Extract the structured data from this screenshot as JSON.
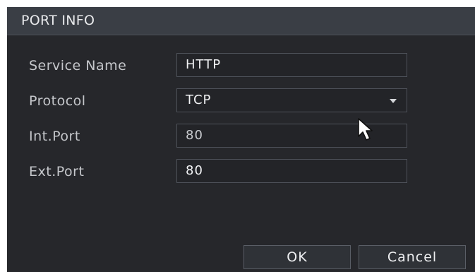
{
  "dialog": {
    "title": "PORT INFO",
    "fields": [
      {
        "label": "Service Name",
        "value": "HTTP"
      },
      {
        "label": "Protocol",
        "value": "TCP"
      },
      {
        "label": "Int.Port",
        "value": "80"
      },
      {
        "label": "Ext.Port",
        "value": "80"
      }
    ],
    "buttons": {
      "ok": "OK",
      "cancel": "Cancel"
    }
  },
  "colors": {
    "background": "#26272b",
    "titlebar": "#3a3e45",
    "field_border": "#4e525a"
  },
  "icons": [
    "chevron-down-icon",
    "mouse-cursor-icon"
  ]
}
